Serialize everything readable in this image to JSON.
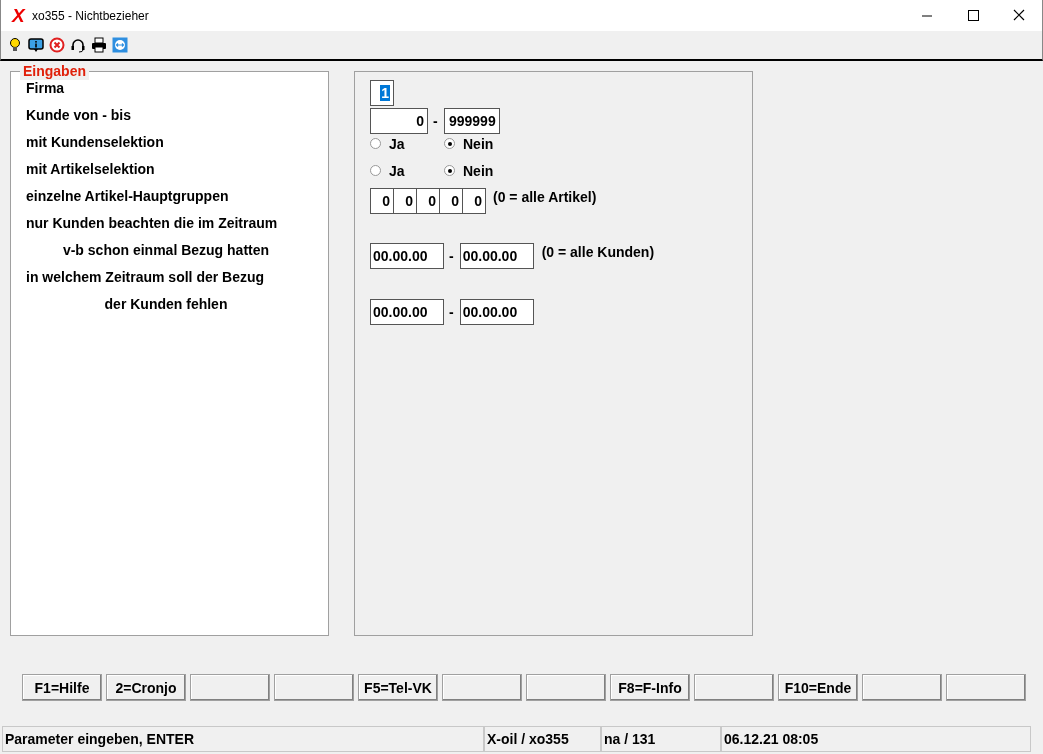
{
  "window": {
    "logo": "X",
    "title": "xo355 - Nichtbezieher"
  },
  "group": {
    "legend": "Eingaben",
    "labels": [
      {
        "text": "Firma",
        "kind": "line"
      },
      {
        "text": "Kunde von - bis",
        "kind": "line"
      },
      {
        "text": "mit Kundenselektion",
        "kind": "line"
      },
      {
        "text": "mit Artikelselektion",
        "kind": "line"
      },
      {
        "text": "einzelne Artikel-Hauptgruppen",
        "kind": "line"
      },
      {
        "text": "nur Kunden beachten die im Zeitraum",
        "kind": "line"
      },
      {
        "text": "v-b schon einmal Bezug hatten",
        "kind": "continuation"
      },
      {
        "text": "in welchem Zeitraum soll der Bezug",
        "kind": "line"
      },
      {
        "text": "der Kunden fehlen",
        "kind": "continuation"
      }
    ]
  },
  "form": {
    "rows": [
      {
        "kind": "firma",
        "fields": [
          {
            "value": "1",
            "highlighted": true
          }
        ]
      },
      {
        "kind": "range",
        "fields": [
          {
            "value": "0"
          },
          {
            "value": "999999"
          }
        ],
        "separator": "-"
      },
      {
        "kind": "radios",
        "options": [
          {
            "label": "Ja",
            "selected": false
          },
          {
            "label": "Nein",
            "selected": true
          }
        ]
      },
      {
        "kind": "radios",
        "options": [
          {
            "label": "Ja",
            "selected": false
          },
          {
            "label": "Nein",
            "selected": true
          }
        ]
      },
      {
        "kind": "groups",
        "fields": [
          {
            "value": "0"
          },
          {
            "value": "0"
          },
          {
            "value": "0"
          },
          {
            "value": "0"
          },
          {
            "value": "0"
          }
        ],
        "note": "(0 = alle Artikel)"
      },
      {
        "kind": "dates",
        "fields": [
          {
            "value": "00.00.00"
          },
          {
            "value": "00.00.00"
          }
        ],
        "separator": "-",
        "note": "(0 = alle Kunden)"
      },
      {
        "kind": "dates",
        "fields": [
          {
            "value": "00.00.00"
          },
          {
            "value": "00.00.00"
          }
        ],
        "separator": "-"
      }
    ]
  },
  "function_keys": [
    {
      "kind": "labeled",
      "label": "F1=Hilfe"
    },
    {
      "kind": "labeled",
      "label": "2=Cronjo"
    },
    {
      "kind": "blank"
    },
    {
      "kind": "blank"
    },
    {
      "kind": "labeled",
      "label": "F5=Tel-VK"
    },
    {
      "kind": "blank"
    },
    {
      "kind": "blank"
    },
    {
      "kind": "labeled",
      "label": "F8=F-Info"
    },
    {
      "kind": "blank"
    },
    {
      "kind": "labeled",
      "label": "F10=Ende"
    },
    {
      "kind": "blank"
    },
    {
      "kind": "blank"
    }
  ],
  "status_bar": [
    "Parameter eingeben, ENTER",
    "X-oil / xo355",
    "na / 131",
    "06.12.21 08:05"
  ]
}
